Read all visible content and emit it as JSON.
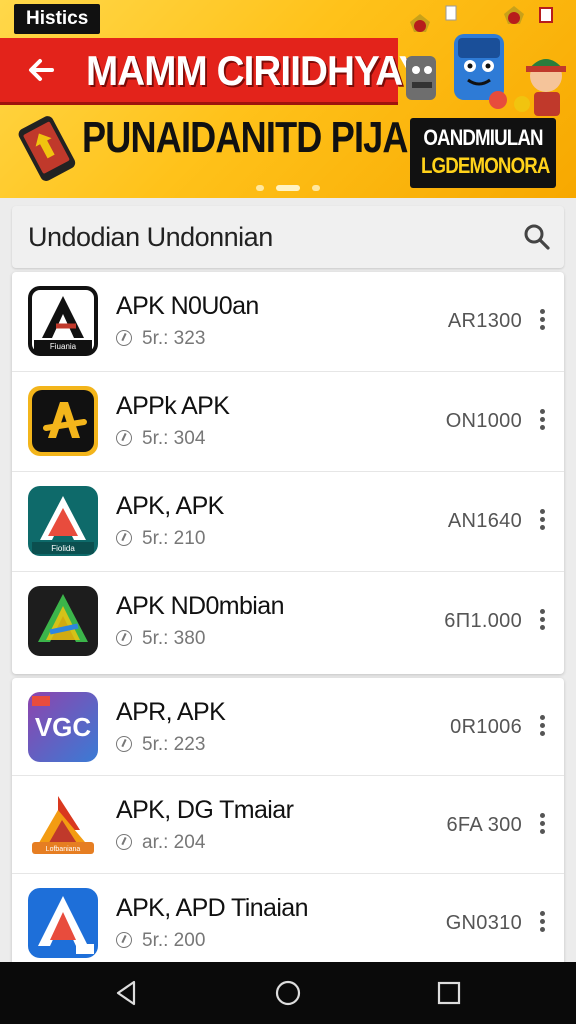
{
  "banner": {
    "tag": "Histics",
    "headline": "MAMM CIRIIDHYAY",
    "subline": "PUNAIDANITD PIJAI",
    "promo_line1": "OANDMIULAN",
    "promo_line2": "LGDEMONORA"
  },
  "search": {
    "text": "Undodian Undonnian",
    "icon": "search-icon"
  },
  "apps": [
    {
      "name": "APK N0U0an",
      "meta": "5r.: 323",
      "size": "AR1300",
      "icon_text": "Fiuania"
    },
    {
      "name": "APPk APK",
      "meta": "5r.: 304",
      "size": "ON1000",
      "icon_text": ""
    },
    {
      "name": "APK, APK",
      "meta": "5r.: 210",
      "size": "AN1640",
      "icon_text": "Fiolida"
    },
    {
      "name": "APK ND0mbian",
      "meta": "5r.: 380",
      "size": "6Π1.000",
      "icon_text": ""
    },
    {
      "name": "APR, APK",
      "meta": "5r.: 223",
      "size": "0R1006",
      "icon_text": "VGC"
    },
    {
      "name": "APK, DG Tmaiar",
      "meta": "ar.: 204",
      "size": "6FA 300",
      "icon_text": "Lofbaniana"
    },
    {
      "name": "APK, APD Tinaian",
      "meta": "5r.: 200",
      "size": "GN0310",
      "icon_text": ""
    }
  ],
  "colors": {
    "banner_yellow": "#ffc21a",
    "banner_red": "#e3231b",
    "nav_bg": "#0a0a0a"
  },
  "nav": {
    "back": "back-icon",
    "home": "home-icon",
    "recents": "recents-icon"
  }
}
